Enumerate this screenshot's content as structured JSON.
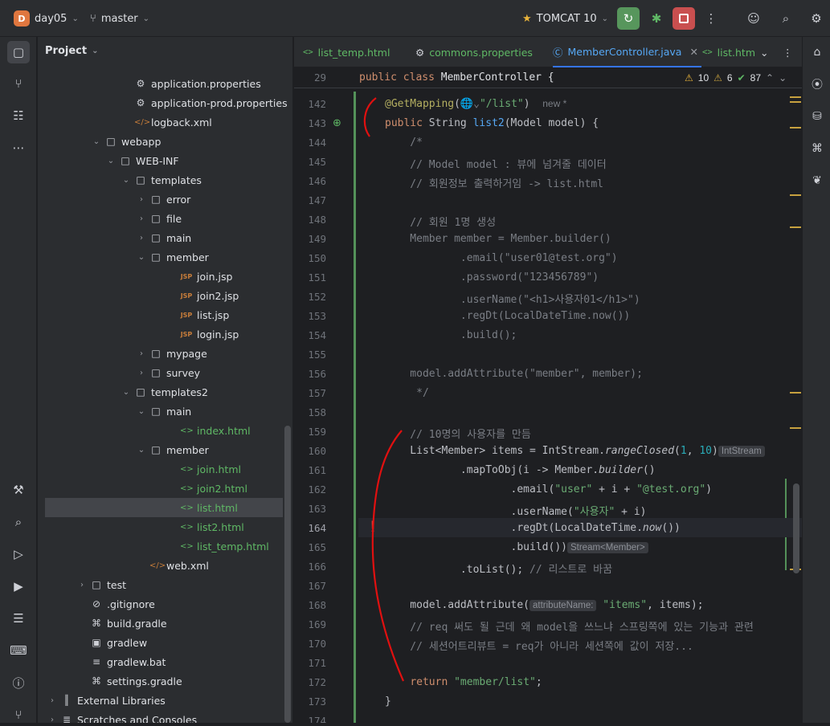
{
  "titlebar": {
    "project_letter": "D",
    "project_name": "day05",
    "branch": "master",
    "run_config": "TOMCAT 10"
  },
  "project_panel": {
    "title": "Project",
    "tree": [
      {
        "label": "application.properties",
        "indent": 105,
        "icon": "gear-icon",
        "arrow": ""
      },
      {
        "label": "application-prod.properties",
        "indent": 105,
        "icon": "gear-icon",
        "arrow": ""
      },
      {
        "label": "logback.xml",
        "indent": 105,
        "icon": "xml-icon",
        "arrow": ""
      },
      {
        "label": "webapp",
        "indent": 68,
        "icon": "folder-icon",
        "arrow": "open"
      },
      {
        "label": "WEB-INF",
        "indent": 86,
        "icon": "folder-icon",
        "arrow": "open"
      },
      {
        "label": "templates",
        "indent": 105,
        "icon": "folder-icon",
        "arrow": "open"
      },
      {
        "label": "error",
        "indent": 124,
        "icon": "folder-icon",
        "arrow": "closed"
      },
      {
        "label": "file",
        "indent": 124,
        "icon": "folder-icon",
        "arrow": "closed"
      },
      {
        "label": "main",
        "indent": 124,
        "icon": "folder-icon",
        "arrow": "closed"
      },
      {
        "label": "member",
        "indent": 124,
        "icon": "folder-icon",
        "arrow": "open"
      },
      {
        "label": "join.jsp",
        "indent": 162,
        "icon": "jsp-icon",
        "arrow": ""
      },
      {
        "label": "join2.jsp",
        "indent": 162,
        "icon": "jsp-icon",
        "arrow": ""
      },
      {
        "label": "list.jsp",
        "indent": 162,
        "icon": "jsp-icon",
        "arrow": ""
      },
      {
        "label": "login.jsp",
        "indent": 162,
        "icon": "jsp-icon",
        "arrow": ""
      },
      {
        "label": "mypage",
        "indent": 124,
        "icon": "folder-icon",
        "arrow": "closed"
      },
      {
        "label": "survey",
        "indent": 124,
        "icon": "folder-icon",
        "arrow": "closed"
      },
      {
        "label": "templates2",
        "indent": 105,
        "icon": "folder-icon",
        "arrow": "open"
      },
      {
        "label": "main",
        "indent": 124,
        "icon": "folder-icon",
        "arrow": "open"
      },
      {
        "label": "index.html",
        "indent": 162,
        "icon": "html-icon",
        "arrow": ""
      },
      {
        "label": "member",
        "indent": 124,
        "icon": "folder-icon",
        "arrow": "open"
      },
      {
        "label": "join.html",
        "indent": 162,
        "icon": "html-icon",
        "arrow": ""
      },
      {
        "label": "join2.html",
        "indent": 162,
        "icon": "html-icon",
        "arrow": ""
      },
      {
        "label": "list.html",
        "indent": 162,
        "icon": "html-icon",
        "arrow": "",
        "selected": true
      },
      {
        "label": "list2.html",
        "indent": 162,
        "icon": "html-icon",
        "arrow": ""
      },
      {
        "label": "list_temp.html",
        "indent": 162,
        "icon": "html-icon",
        "arrow": ""
      },
      {
        "label": "web.xml",
        "indent": 124,
        "icon": "xml-icon",
        "arrow": ""
      },
      {
        "label": "test",
        "indent": 50,
        "icon": "folder-icon",
        "arrow": "closed"
      },
      {
        "label": ".gitignore",
        "indent": 50,
        "icon": "ignore-icon",
        "arrow": ""
      },
      {
        "label": "build.gradle",
        "indent": 50,
        "icon": "gradle-icon",
        "arrow": ""
      },
      {
        "label": "gradlew",
        "indent": 50,
        "icon": "terminal-file-icon",
        "arrow": ""
      },
      {
        "label": "gradlew.bat",
        "indent": 50,
        "icon": "text-file-icon",
        "arrow": ""
      },
      {
        "label": "settings.gradle",
        "indent": 50,
        "icon": "gradle-icon",
        "arrow": ""
      },
      {
        "label": "External Libraries",
        "indent": 13,
        "icon": "library-icon",
        "arrow": "closed"
      },
      {
        "label": "Scratches and Consoles",
        "indent": 13,
        "icon": "scratch-icon",
        "arrow": "closed"
      }
    ]
  },
  "tabs": [
    {
      "label": "list_temp.html",
      "icon": "html-icon"
    },
    {
      "label": "commons.properties",
      "icon": "gear-icon"
    },
    {
      "label": "MemberController.java",
      "icon": "class-icon",
      "active": true
    },
    {
      "label": "list.htm",
      "icon": "html-icon"
    }
  ],
  "editor": {
    "sticky_line": "29",
    "sticky_code": "public class MemberController {",
    "warnings": "10",
    "weak_warnings": "6",
    "typos": "87",
    "inlay_new": "new *",
    "hint_intstream": "IntStream",
    "hint_stream": "Stream<Member>",
    "hint_attr": "attributeName:",
    "line_numbers": [
      "142",
      "143",
      "144",
      "145",
      "146",
      "147",
      "148",
      "149",
      "150",
      "151",
      "152",
      "153",
      "154",
      "155",
      "156",
      "157",
      "158",
      "159",
      "160",
      "161",
      "162",
      "163",
      "164",
      "165",
      "166",
      "167",
      "168",
      "169",
      "170",
      "171",
      "172",
      "173",
      "174"
    ]
  },
  "colors": {
    "accent": "#3574f0",
    "run_green": "#57965c",
    "stop_red": "#c94f4f",
    "annotation_red": "#e01010"
  }
}
